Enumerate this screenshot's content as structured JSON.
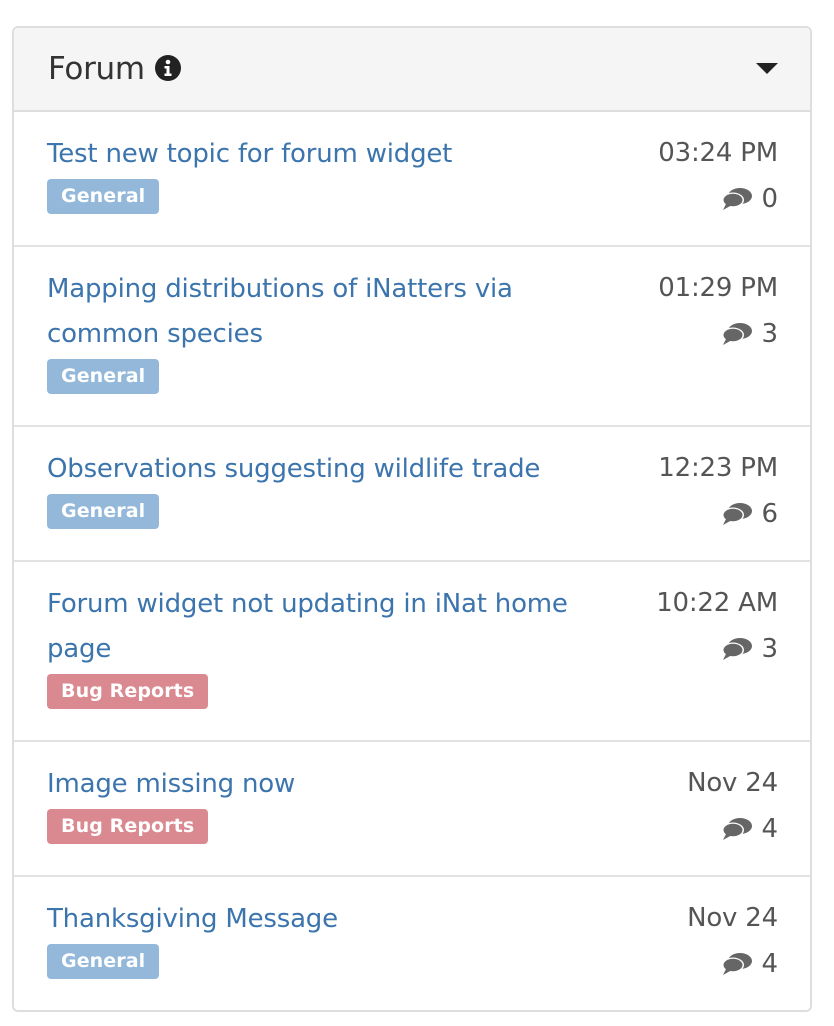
{
  "widget": {
    "title": "Forum",
    "info_icon": "info-circle-icon",
    "toggle_icon": "caret-down-icon"
  },
  "colors": {
    "link": "#3c75ad",
    "general_badge": "#93b8d9",
    "bug_badge": "#d9898f",
    "header_bg": "#f5f5f5",
    "meta_text": "#555555"
  },
  "topics": [
    {
      "title": "Test new topic for forum widget",
      "category": "General",
      "category_type": "general",
      "time": "03:24 PM",
      "replies": "0"
    },
    {
      "title": "Mapping distributions of iNatters via common species",
      "category": "General",
      "category_type": "general",
      "time": "01:29 PM",
      "replies": "3"
    },
    {
      "title": "Observations suggesting wildlife trade",
      "category": "General",
      "category_type": "general",
      "time": "12:23 PM",
      "replies": "6"
    },
    {
      "title": "Forum widget not updating in iNat home page",
      "category": "Bug Reports",
      "category_type": "bug",
      "time": "10:22 AM",
      "replies": "3"
    },
    {
      "title": "Image missing now",
      "category": "Bug Reports",
      "category_type": "bug",
      "time": "Nov 24",
      "replies": "4"
    },
    {
      "title": "Thanksgiving Message",
      "category": "General",
      "category_type": "general",
      "time": "Nov 24",
      "replies": "4"
    }
  ]
}
